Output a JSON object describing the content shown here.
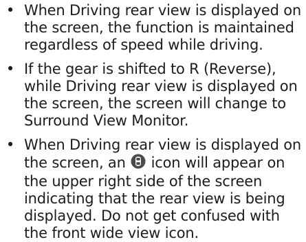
{
  "bullets": [
    {
      "text": "When Driving rear view is displayed on the screen, the function is maintained regardless of speed while driving."
    },
    {
      "text": "If the gear is shifted to R (Reverse), while Driving rear view is displayed on the screen, the screen will change to Surround View Monitor."
    },
    {
      "text_before": "When Driving rear view is displayed on the screen, an",
      "icon": "rear-camera-icon",
      "text_after": "icon will appear on the upper right side of the screen indicating that the rear view is being displayed. Do not get confused with the front wide view icon."
    }
  ],
  "bullet_symbol": "•",
  "colors": {
    "text": "#1c1c1c",
    "icon_fill": "#4a4a4a"
  }
}
